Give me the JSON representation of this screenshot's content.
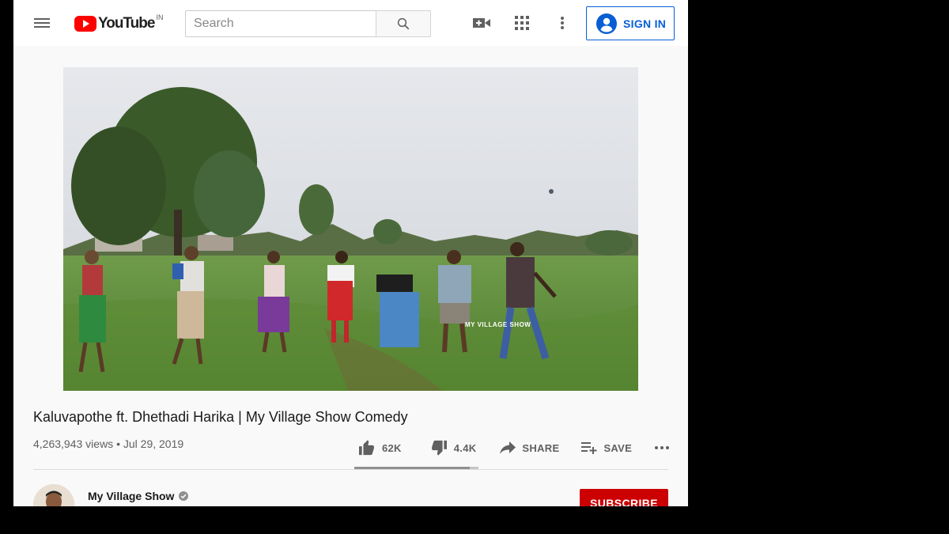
{
  "header": {
    "logo_text": "YouTube",
    "country_code": "IN",
    "search_placeholder": "Search",
    "signin_label": "SIGN IN",
    "icons": [
      "menu-icon",
      "search-icon",
      "create-video-icon",
      "apps-grid-icon",
      "more-vert-icon",
      "account-circle-icon"
    ]
  },
  "video": {
    "title": "Kaluvapothe ft. Dhethadi Harika | My Village Show Comedy",
    "views": "4,263,943 views",
    "date": "Jul 29, 2019",
    "watermark": "MY VILLAGE SHOW"
  },
  "actions": {
    "likes": "62K",
    "dislikes": "4.4K",
    "share_label": "SHARE",
    "save_label": "SAVE",
    "like_ratio": 0.93
  },
  "channel": {
    "name": "My Village Show",
    "subscribe_label": "SUBSCRIBE"
  },
  "colors": {
    "brand_red": "#ff0000",
    "link_blue": "#065fd4",
    "subscribe_red": "#cc0000"
  }
}
